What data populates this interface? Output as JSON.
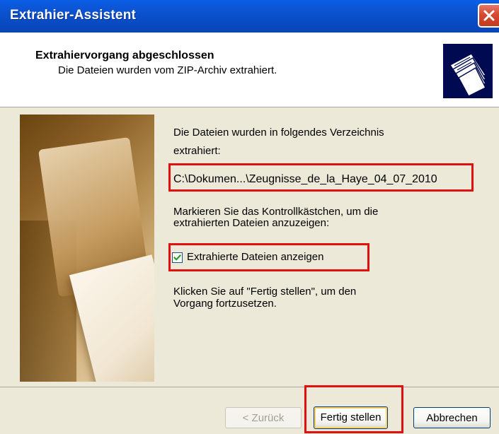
{
  "window": {
    "title": "Extrahier-Assistent",
    "close_icon": "close-icon"
  },
  "header": {
    "title": "Extrahiervorgang abgeschlossen",
    "subtitle": "Die Dateien wurden vom ZIP-Archiv extrahiert.",
    "icon": "folders-icon"
  },
  "content": {
    "intro_line1": "Die Dateien wurden in folgendes Verzeichnis",
    "intro_line2": "extrahiert:",
    "path": "C:\\Dokumen...\\Zeugnisse_de_la_Haye_04_07_2010",
    "checkbox_instr_line1": "Markieren Sie das Kontrollkästchen, um die",
    "checkbox_instr_line2": "extrahierten Dateien anzuzeigen:",
    "checkbox_label": "Extrahierte Dateien anzeigen",
    "checkbox_checked": true,
    "finish_instr_line1": "Klicken Sie auf \"Fertig stellen\", um den",
    "finish_instr_line2": "Vorgang fortzusetzen."
  },
  "buttons": {
    "back": "< Zurück",
    "finish": "Fertig stellen",
    "cancel": "Abbrechen"
  },
  "colors": {
    "titlebar": "#0a4ec8",
    "highlight": "#e01010",
    "dialog_bg": "#ece9d8"
  }
}
